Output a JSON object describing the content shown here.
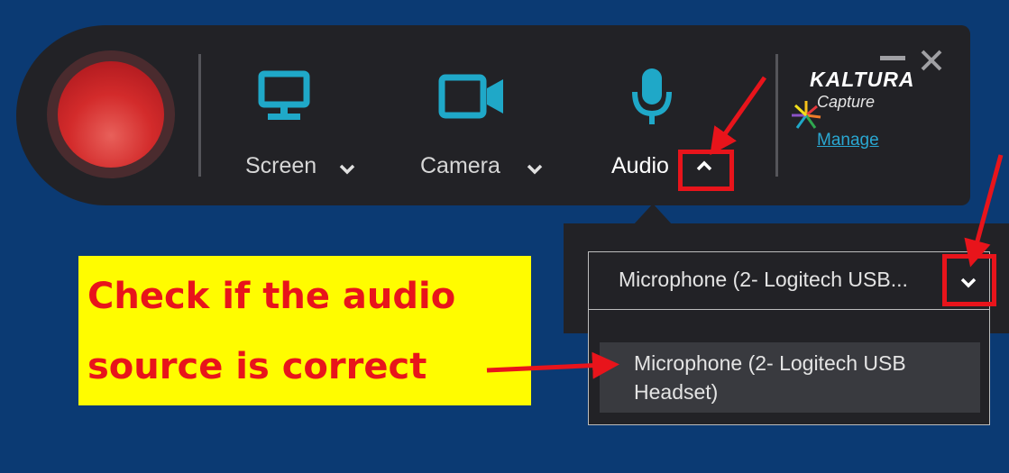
{
  "toolbar": {
    "record_button": "record-button",
    "sources": [
      {
        "label": "Screen",
        "icon": "monitor-icon"
      },
      {
        "label": "Camera",
        "icon": "video-camera-icon"
      },
      {
        "label": "Audio",
        "icon": "microphone-icon"
      }
    ],
    "logo": {
      "brand": "KALTURA",
      "product": "Capture"
    },
    "manage_label": "Manage",
    "minimize_icon": "minimize-icon",
    "close_icon": "close-icon"
  },
  "audio_dropdown": {
    "selected_value": "Microphone (2- Logitech USB...",
    "options": [
      "Microphone (2- Logitech USB Headset)"
    ]
  },
  "annotation": {
    "callout_text": "Check if the audio\nsource is correct"
  },
  "colors": {
    "background": "#0b3a73",
    "toolbar": "#222226",
    "accent": "#2aa7d1",
    "record": "#d32b2b",
    "annotation_red": "#e8141b",
    "callout_yellow": "#fffc00"
  }
}
